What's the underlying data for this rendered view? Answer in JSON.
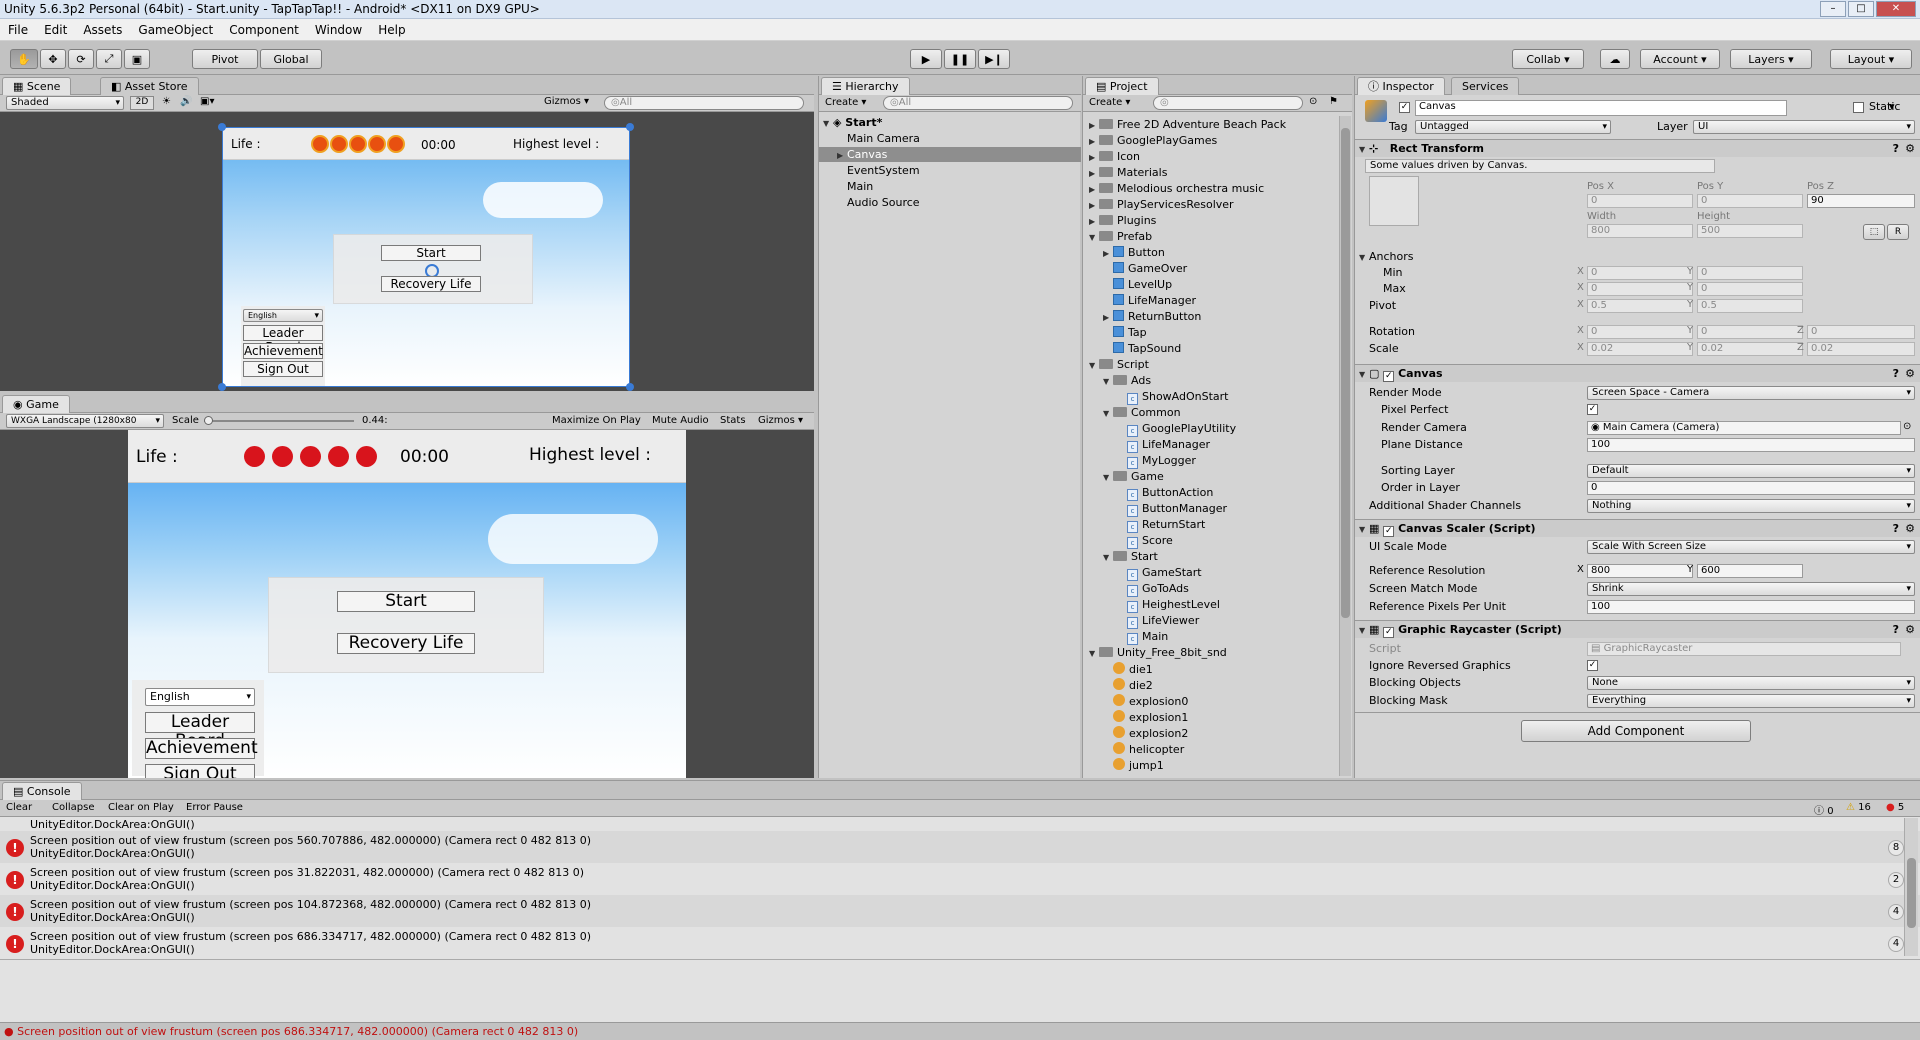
{
  "title": "Unity 5.6.3p2 Personal (64bit) - Start.unity - TapTapTap!! - Android* <DX11 on DX9 GPU>",
  "menu": [
    "File",
    "Edit",
    "Assets",
    "GameObject",
    "Component",
    "Window",
    "Help"
  ],
  "toolbar": {
    "pivot": "Pivot",
    "global": "Global",
    "collab": "Collab",
    "account": "Account",
    "layers": "Layers",
    "layout": "Layout"
  },
  "scene": {
    "tab": "Scene",
    "tab2": "Asset Store",
    "shaded": "Shaded",
    "mode2d": "2D",
    "gizmos": "Gizmos",
    "search": "All"
  },
  "game_ui": {
    "life": "Life :",
    "time": "00:00",
    "highest": "Highest level :",
    "start": "Start",
    "recovery": "Recovery Life",
    "language": "English",
    "leader": "Leader Board",
    "achievement": "Achievement",
    "signout": "Sign Out"
  },
  "game": {
    "tab": "Game",
    "resolution": "WXGA Landscape (1280x80",
    "scale": "Scale",
    "scale_val": "0.44:",
    "maximize": "Maximize On Play",
    "mute": "Mute Audio",
    "stats": "Stats",
    "gizmos": "Gizmos"
  },
  "hierarchy": {
    "tab": "Hierarchy",
    "create": "Create",
    "search": "All",
    "root": "Start*",
    "items": [
      "Main Camera",
      "Canvas",
      "EventSystem",
      "Main",
      "Audio Source"
    ]
  },
  "project": {
    "tab": "Project",
    "create": "Create",
    "rows": [
      {
        "t": "folder",
        "label": "Free 2D Adventure Beach Pack",
        "d": 0,
        "a": "▶"
      },
      {
        "t": "folder",
        "label": "GooglePlayGames",
        "d": 0,
        "a": "▶"
      },
      {
        "t": "folder",
        "label": "Icon",
        "d": 0,
        "a": "▶"
      },
      {
        "t": "folder",
        "label": "Materials",
        "d": 0,
        "a": "▶"
      },
      {
        "t": "folder",
        "label": "Melodious orchestra music",
        "d": 0,
        "a": "▶"
      },
      {
        "t": "folder",
        "label": "PlayServicesResolver",
        "d": 0,
        "a": "▶"
      },
      {
        "t": "folder",
        "label": "Plugins",
        "d": 0,
        "a": "▶"
      },
      {
        "t": "folder",
        "label": "Prefab",
        "d": 0,
        "a": "▼"
      },
      {
        "t": "prefab",
        "label": "Button",
        "d": 1,
        "a": "▶"
      },
      {
        "t": "prefab",
        "label": "GameOver",
        "d": 1,
        "a": ""
      },
      {
        "t": "prefab",
        "label": "LevelUp",
        "d": 1,
        "a": ""
      },
      {
        "t": "prefab",
        "label": "LifeManager",
        "d": 1,
        "a": ""
      },
      {
        "t": "prefab",
        "label": "ReturnButton",
        "d": 1,
        "a": "▶"
      },
      {
        "t": "prefab",
        "label": "Tap",
        "d": 1,
        "a": ""
      },
      {
        "t": "prefab",
        "label": "TapSound",
        "d": 1,
        "a": ""
      },
      {
        "t": "folder",
        "label": "Script",
        "d": 0,
        "a": "▼"
      },
      {
        "t": "folder",
        "label": "Ads",
        "d": 1,
        "a": "▼"
      },
      {
        "t": "script",
        "label": "ShowAdOnStart",
        "d": 2,
        "a": ""
      },
      {
        "t": "folder",
        "label": "Common",
        "d": 1,
        "a": "▼"
      },
      {
        "t": "script",
        "label": "GooglePlayUtility",
        "d": 2,
        "a": ""
      },
      {
        "t": "script",
        "label": "LifeManager",
        "d": 2,
        "a": ""
      },
      {
        "t": "script",
        "label": "MyLogger",
        "d": 2,
        "a": ""
      },
      {
        "t": "folder",
        "label": "Game",
        "d": 1,
        "a": "▼"
      },
      {
        "t": "script",
        "label": "ButtonAction",
        "d": 2,
        "a": ""
      },
      {
        "t": "script",
        "label": "ButtonManager",
        "d": 2,
        "a": ""
      },
      {
        "t": "script",
        "label": "ReturnStart",
        "d": 2,
        "a": ""
      },
      {
        "t": "script",
        "label": "Score",
        "d": 2,
        "a": ""
      },
      {
        "t": "folder",
        "label": "Start",
        "d": 1,
        "a": "▼"
      },
      {
        "t": "script",
        "label": "GameStart",
        "d": 2,
        "a": ""
      },
      {
        "t": "script",
        "label": "GoToAds",
        "d": 2,
        "a": ""
      },
      {
        "t": "script",
        "label": "HeighestLevel",
        "d": 2,
        "a": ""
      },
      {
        "t": "script",
        "label": "LifeViewer",
        "d": 2,
        "a": ""
      },
      {
        "t": "script",
        "label": "Main",
        "d": 2,
        "a": ""
      },
      {
        "t": "folder",
        "label": "Unity_Free_8bit_snd",
        "d": 0,
        "a": "▼"
      },
      {
        "t": "audio",
        "label": "die1",
        "d": 1,
        "a": ""
      },
      {
        "t": "audio",
        "label": "die2",
        "d": 1,
        "a": ""
      },
      {
        "t": "audio",
        "label": "explosion0",
        "d": 1,
        "a": ""
      },
      {
        "t": "audio",
        "label": "explosion1",
        "d": 1,
        "a": ""
      },
      {
        "t": "audio",
        "label": "explosion2",
        "d": 1,
        "a": ""
      },
      {
        "t": "audio",
        "label": "helicopter",
        "d": 1,
        "a": ""
      },
      {
        "t": "audio",
        "label": "jump1",
        "d": 1,
        "a": ""
      }
    ]
  },
  "inspector": {
    "tab": "Inspector",
    "tab2": "Services",
    "name": "Canvas",
    "static": "Static",
    "tag_label": "Tag",
    "tag": "Untagged",
    "layer_label": "Layer",
    "layer": "UI",
    "rect_title": "Rect Transform",
    "driven": "Some values driven by Canvas.",
    "posx_l": "Pos X",
    "posy_l": "Pos Y",
    "posz_l": "Pos Z",
    "posx": "0",
    "posy": "0",
    "posz": "90",
    "width_l": "Width",
    "height_l": "Height",
    "width": "800",
    "height": "500",
    "r": "R",
    "anchors": "Anchors",
    "min": "Min",
    "max": "Max",
    "pivot": "Pivot",
    "rotation": "Rotation",
    "scale": "Scale",
    "ax": "X",
    "ay": "Y",
    "az": "Z",
    "minx": "0",
    "miny": "0",
    "maxx": "0",
    "maxy": "0",
    "pivx": "0.5",
    "pivy": "0.5",
    "rotx": "0",
    "roty": "0",
    "rotz": "0",
    "scx": "0.02",
    "scy": "0.02",
    "scz": "0.02",
    "canvas_title": "Canvas",
    "render_mode_l": "Render Mode",
    "render_mode": "Screen Space - Camera",
    "pixel_perfect": "Pixel Perfect",
    "render_camera_l": "Render Camera",
    "render_camera": "Main Camera (Camera)",
    "plane_l": "Plane Distance",
    "plane": "100",
    "sorting_l": "Sorting Layer",
    "sorting": "Default",
    "order_l": "Order in Layer",
    "order": "0",
    "shader_l": "Additional Shader Channels",
    "shader": "Nothing",
    "scaler_title": "Canvas Scaler (Script)",
    "uiscale_l": "UI Scale Mode",
    "uiscale": "Scale With Screen Size",
    "refres_l": "Reference Resolution",
    "refx": "800",
    "refy": "600",
    "match_l": "Screen Match Mode",
    "match": "Shrink",
    "ppu_l": "Reference Pixels Per Unit",
    "ppu": "100",
    "raycaster_title": "Graphic Raycaster (Script)",
    "script_l": "Script",
    "script": "GraphicRaycaster",
    "ignore_l": "Ignore Reversed Graphics",
    "blocking_l": "Blocking Objects",
    "blocking": "None",
    "mask_l": "Blocking Mask",
    "mask": "Everything",
    "add": "Add Component"
  },
  "console": {
    "tab": "Console",
    "clear": "Clear",
    "collapse": "Collapse",
    "clear_play": "Clear on Play",
    "error_pause": "Error Pause",
    "c_info": "0",
    "c_warn": "16",
    "c_err": "5",
    "top_line": "UnityEditor.DockArea:OnGUI()",
    "rows": [
      {
        "l1": "Screen position out of view frustum (screen pos 560.707886, 482.000000) (Camera rect 0 482 813 0)",
        "l2": "UnityEditor.DockArea:OnGUI()",
        "n": "8"
      },
      {
        "l1": "Screen position out of view frustum (screen pos 31.822031, 482.000000) (Camera rect 0 482 813 0)",
        "l2": "UnityEditor.DockArea:OnGUI()",
        "n": "2"
      },
      {
        "l1": "Screen position out of view frustum (screen pos 104.872368, 482.000000) (Camera rect 0 482 813 0)",
        "l2": "UnityEditor.DockArea:OnGUI()",
        "n": "4"
      },
      {
        "l1": "Screen position out of view frustum (screen pos 686.334717, 482.000000) (Camera rect 0 482 813 0)",
        "l2": "UnityEditor.DockArea:OnGUI()",
        "n": "4"
      }
    ]
  },
  "status": "Screen position out of view frustum (screen pos 686.334717, 482.000000) (Camera rect 0 482 813 0)"
}
